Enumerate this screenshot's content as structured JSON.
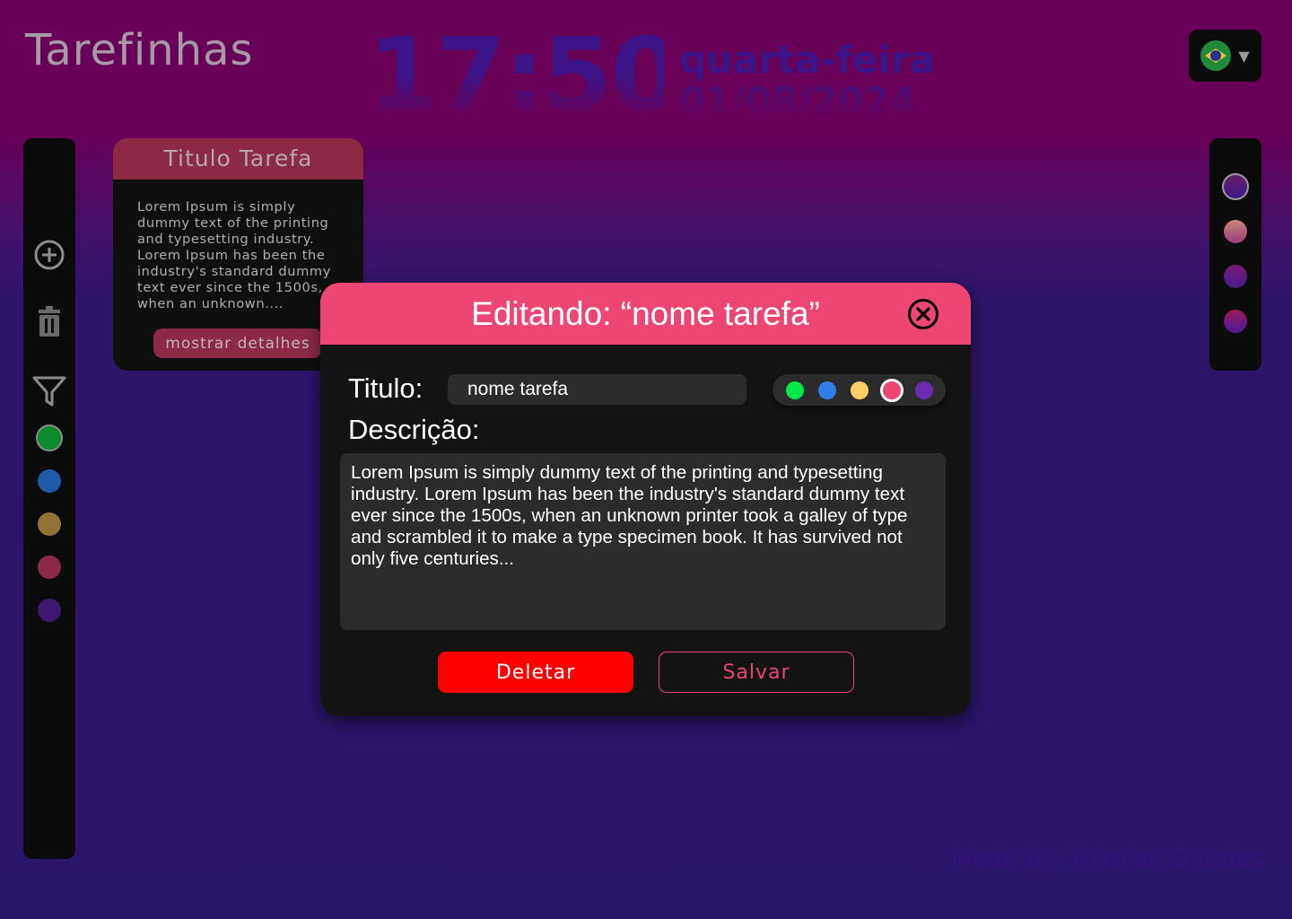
{
  "app": {
    "title": "Tarefinhas"
  },
  "clock": {
    "time": "17:50",
    "weekday": "quarta-feira",
    "date": "01/08/2024"
  },
  "language": {
    "flag_icon": "brazil-flag-icon",
    "dropdown_icon": "caret-down-icon"
  },
  "sidebar": {
    "icons": [
      "add-circle-icon",
      "trash-icon",
      "filter-icon"
    ],
    "filter_colors": [
      "#0c8a2c",
      "#1e5aa8",
      "#8f7436",
      "#8c2a45",
      "#3d1873"
    ]
  },
  "theme_bar": {
    "colors": [
      "#4a1a8a",
      "#b7687a",
      "#6a1a8a",
      "#6a1a8a"
    ]
  },
  "task_card": {
    "title": "Titulo Tarefa",
    "body": "Lorem Ipsum is simply dummy text of the printing and typesetting industry. Lorem Ipsum has been the industry's standard dummy text ever since the 1500s, when an unknown....",
    "details_label": "mostrar detalhes",
    "color": "#8c2a45"
  },
  "modal": {
    "title": "Editando: “nome tarefa”",
    "title_label": "Titulo:",
    "title_value": "nome tarefa",
    "description_label": "Descrição:",
    "description_value": "Lorem Ipsum is simply dummy text of the printing and typesetting industry. Lorem Ipsum has been the industry's standard dummy text ever since the 1500s, when an unknown printer took a galley of type and scrambled it to make a type specimen book. It has survived not only five centuries...",
    "colors": [
      "#00e84a",
      "#2f7de8",
      "#ffd066",
      "#ee4672",
      "#6a2bb0"
    ],
    "selected_color": "#ee4672",
    "delete_label": "Deletar",
    "save_label": "Salvar",
    "accent": "#ee4672"
  },
  "footer": {
    "credit": "Made by: Nikolas Guedes"
  }
}
